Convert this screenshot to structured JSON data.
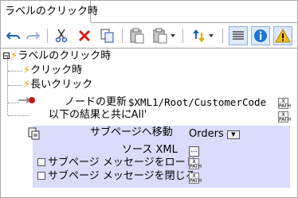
{
  "tab": {
    "label": "ラベルのクリック時"
  },
  "toolbar": {
    "buttons": [
      {
        "name": "undo-icon"
      },
      {
        "name": "redo-icon"
      },
      {
        "name": "cut-icon"
      },
      {
        "name": "delete-icon"
      },
      {
        "name": "copy-icon"
      },
      {
        "name": "paste-icon"
      },
      {
        "name": "paste-special-icon"
      },
      {
        "name": "move-icon"
      },
      {
        "name": "show-xpath-icon"
      },
      {
        "name": "info-icon"
      },
      {
        "name": "warning-icon"
      }
    ]
  },
  "tree": {
    "root": {
      "expander": "⊟",
      "label": "ラベルのクリック時"
    },
    "children": [
      {
        "label": "クリック時"
      },
      {
        "label": "長いクリック"
      }
    ],
    "update_node": {
      "action_label": "ノードの更新",
      "target": "$XML1/Root/CustomerCode",
      "result_label": "以下の結果と共に",
      "result_value": "'All'"
    },
    "subpage": {
      "label": "サブページへ移動",
      "target_value": "Orders",
      "source_xml_label": "ソース XML",
      "load_message_label": "サブページ メッセージをロード",
      "close_message_label": "サブページ メッセージを閉じる"
    }
  },
  "xpath_label": "X PATH"
}
